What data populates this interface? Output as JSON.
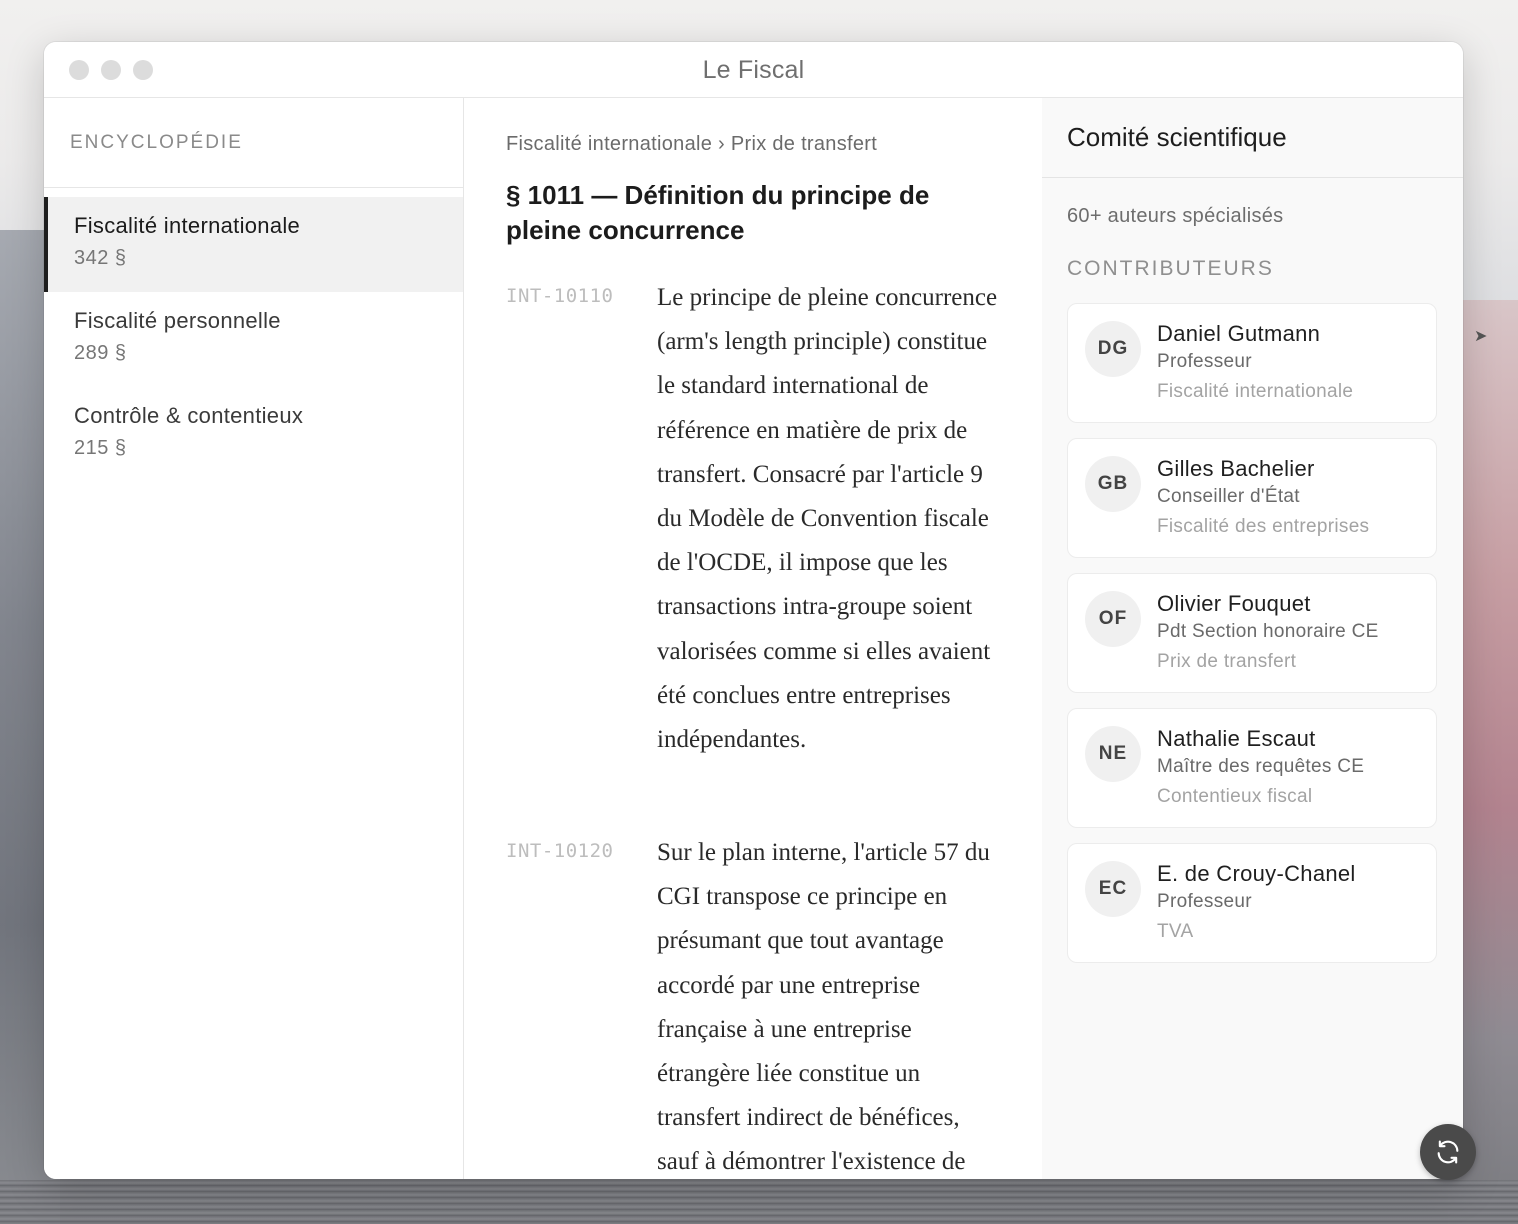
{
  "window": {
    "title": "Le Fiscal"
  },
  "sidebar": {
    "heading": "ENCYCLOPÉDIE",
    "items": [
      {
        "name": "Fiscalité internationale",
        "count": "342 §",
        "active": true
      },
      {
        "name": "Fiscalité personnelle",
        "count": "289 §",
        "active": false
      },
      {
        "name": "Contrôle & contentieux",
        "count": "215 §",
        "active": false
      }
    ]
  },
  "main": {
    "breadcrumb": "Fiscalité internationale › Prix de transfert",
    "title": "§ 1011 — Définition du principe de pleine concurrence",
    "paragraphs": [
      {
        "code": "INT-10110",
        "text": "Le principe de pleine concurrence (arm's length principle) constitue le standard international de référence en matière de prix de transfert. Consacré par l'article 9 du Modèle de Convention fiscale de l'OCDE, il impose que les transactions intra-groupe soient valorisées comme si elles avaient été conclues entre entreprises indépendantes."
      },
      {
        "code": "INT-10120",
        "text": "Sur le plan interne, l'article 57 du CGI transpose ce principe en présumant que tout avantage accordé par une entreprise française à une entreprise étrangère liée constitue un transfert indirect de bénéfices, sauf à démontrer l'existence de"
      }
    ]
  },
  "panel": {
    "title": "Comité scientifique",
    "subtitle": "60+ auteurs spécialisés",
    "section": "CONTRIBUTEURS",
    "contributors": [
      {
        "initials": "DG",
        "name": "Daniel Gutmann",
        "role": "Professeur",
        "field": "Fiscalité internationale"
      },
      {
        "initials": "GB",
        "name": "Gilles Bachelier",
        "role": "Conseiller d'État",
        "field": "Fiscalité des entreprises"
      },
      {
        "initials": "OF",
        "name": "Olivier Fouquet",
        "role": "Pdt Section honoraire CE",
        "field": "Prix de transfert"
      },
      {
        "initials": "NE",
        "name": "Nathalie Escaut",
        "role": "Maître des requêtes CE",
        "field": "Contentieux fiscal"
      },
      {
        "initials": "EC",
        "name": "E. de Crouy-Chanel",
        "role": "Professeur",
        "field": "TVA"
      }
    ]
  },
  "icons": {
    "refresh": "refresh-icon",
    "traffic_lights": "window-control-icon"
  }
}
